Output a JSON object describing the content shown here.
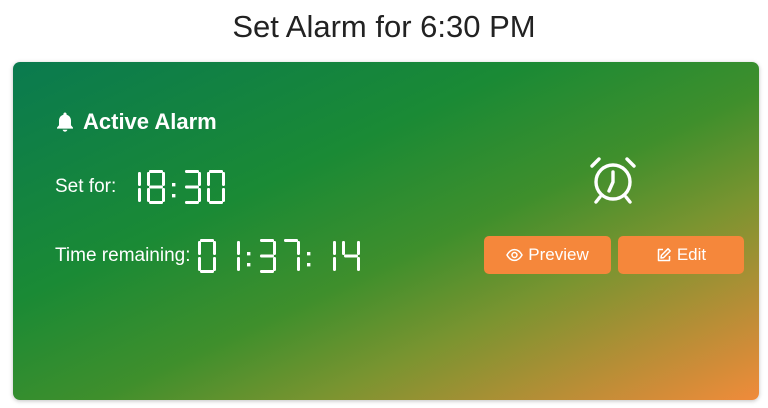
{
  "page": {
    "title": "Set Alarm for 6:30 PM"
  },
  "alarm_card": {
    "heading": "Active Alarm",
    "heading_icon": "bell-icon",
    "set_for_label": "Set for:",
    "set_for_time": "18:30",
    "remaining_label": "Time remaining:",
    "remaining_time": "01:37:14",
    "status_icon": "alarm-clock-icon",
    "buttons": {
      "preview_label": "Preview",
      "preview_icon": "eye-icon",
      "edit_label": "Edit",
      "edit_icon": "edit-icon"
    }
  },
  "colors": {
    "gradient_start": "#0a7a4f",
    "gradient_end": "#f08b3a",
    "button_bg": "#f5873b",
    "text": "#ffffff"
  }
}
